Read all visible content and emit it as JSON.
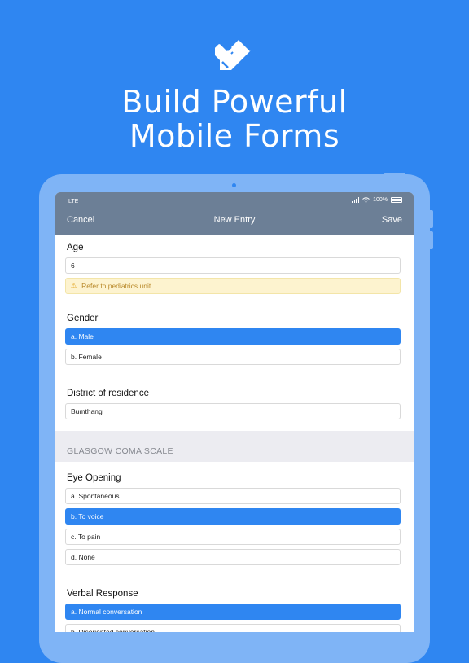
{
  "hero": {
    "icon": "pencil-ruler-icon",
    "headline_line1": "Build Powerful",
    "headline_line2": "Mobile Forms"
  },
  "status_bar": {
    "carrier": "LTE",
    "battery": "100%"
  },
  "nav": {
    "cancel_label": "Cancel",
    "title": "New Entry",
    "save_label": "Save"
  },
  "form": {
    "age": {
      "label": "Age",
      "value": "6",
      "warning": "Refer to pediatrics unit"
    },
    "gender": {
      "label": "Gender",
      "options": [
        "a. Male",
        "b. Female"
      ],
      "selected": 0
    },
    "district": {
      "label": "District of residence",
      "value": "Bumthang"
    },
    "section_header": "GLASGOW COMA SCALE",
    "eye_opening": {
      "label": "Eye Opening",
      "options": [
        "a. Spontaneous",
        "b. To voice",
        "c. To pain",
        "d. None"
      ],
      "selected": 1
    },
    "verbal_response": {
      "label": "Verbal Response",
      "options": [
        "a. Normal conversation",
        "b. Disoriented conversation"
      ],
      "selected": 0
    }
  },
  "colors": {
    "background": "#2f86f1",
    "navbar": "#6c7f96",
    "selected": "#2f86f1",
    "warning_bg": "#fdf3cf"
  }
}
